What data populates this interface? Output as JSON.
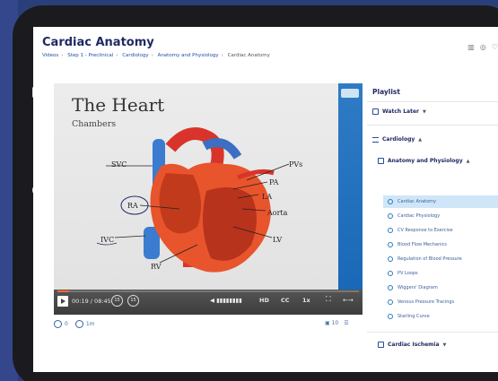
{
  "page": {
    "title": "Cardiac Anatomy",
    "breadcrumbs": [
      "Videos",
      "Step 1 - Preclinical",
      "Cardiology",
      "Anatomy and Physiology",
      "Cardiac Anatomy"
    ]
  },
  "slide": {
    "title": "The Heart",
    "subtitle": "Chambers",
    "labels": {
      "svc": "SVC",
      "pvs": "PVs",
      "pa": "PA",
      "la": "LA",
      "ra": "RA",
      "aorta": "Aorta",
      "ivc": "IVC",
      "lv": "LV",
      "rv": "RV"
    }
  },
  "player": {
    "time": "00:19 / 08:45",
    "rewind": "15",
    "forward": "15",
    "quality": "HD",
    "captions": "CC",
    "speed": "1x",
    "progress_fraction": 0.04
  },
  "stats": {
    "views": "0",
    "duration": "1m",
    "notes": "10"
  },
  "playlist": {
    "title": "Playlist",
    "watch_later": "Watch Later",
    "section": "Cardiology",
    "subsection": "Anatomy and Physiology",
    "items": [
      "Cardiac Anatomy",
      "Cardiac Physiology",
      "CV Response to Exercise",
      "Blood Flow Mechanics",
      "Regulation of Blood Pressure",
      "PV Loops",
      "Wiggers' Diagram",
      "Venous Pressure Tracings",
      "Starling Curve"
    ],
    "next_section": "Cardiac Ischemia"
  },
  "colors": {
    "accent": "#1f2a63",
    "progress": "#ff6b2e",
    "active_item": "#cfe6f8",
    "slide_bar": "#1a68b7"
  }
}
